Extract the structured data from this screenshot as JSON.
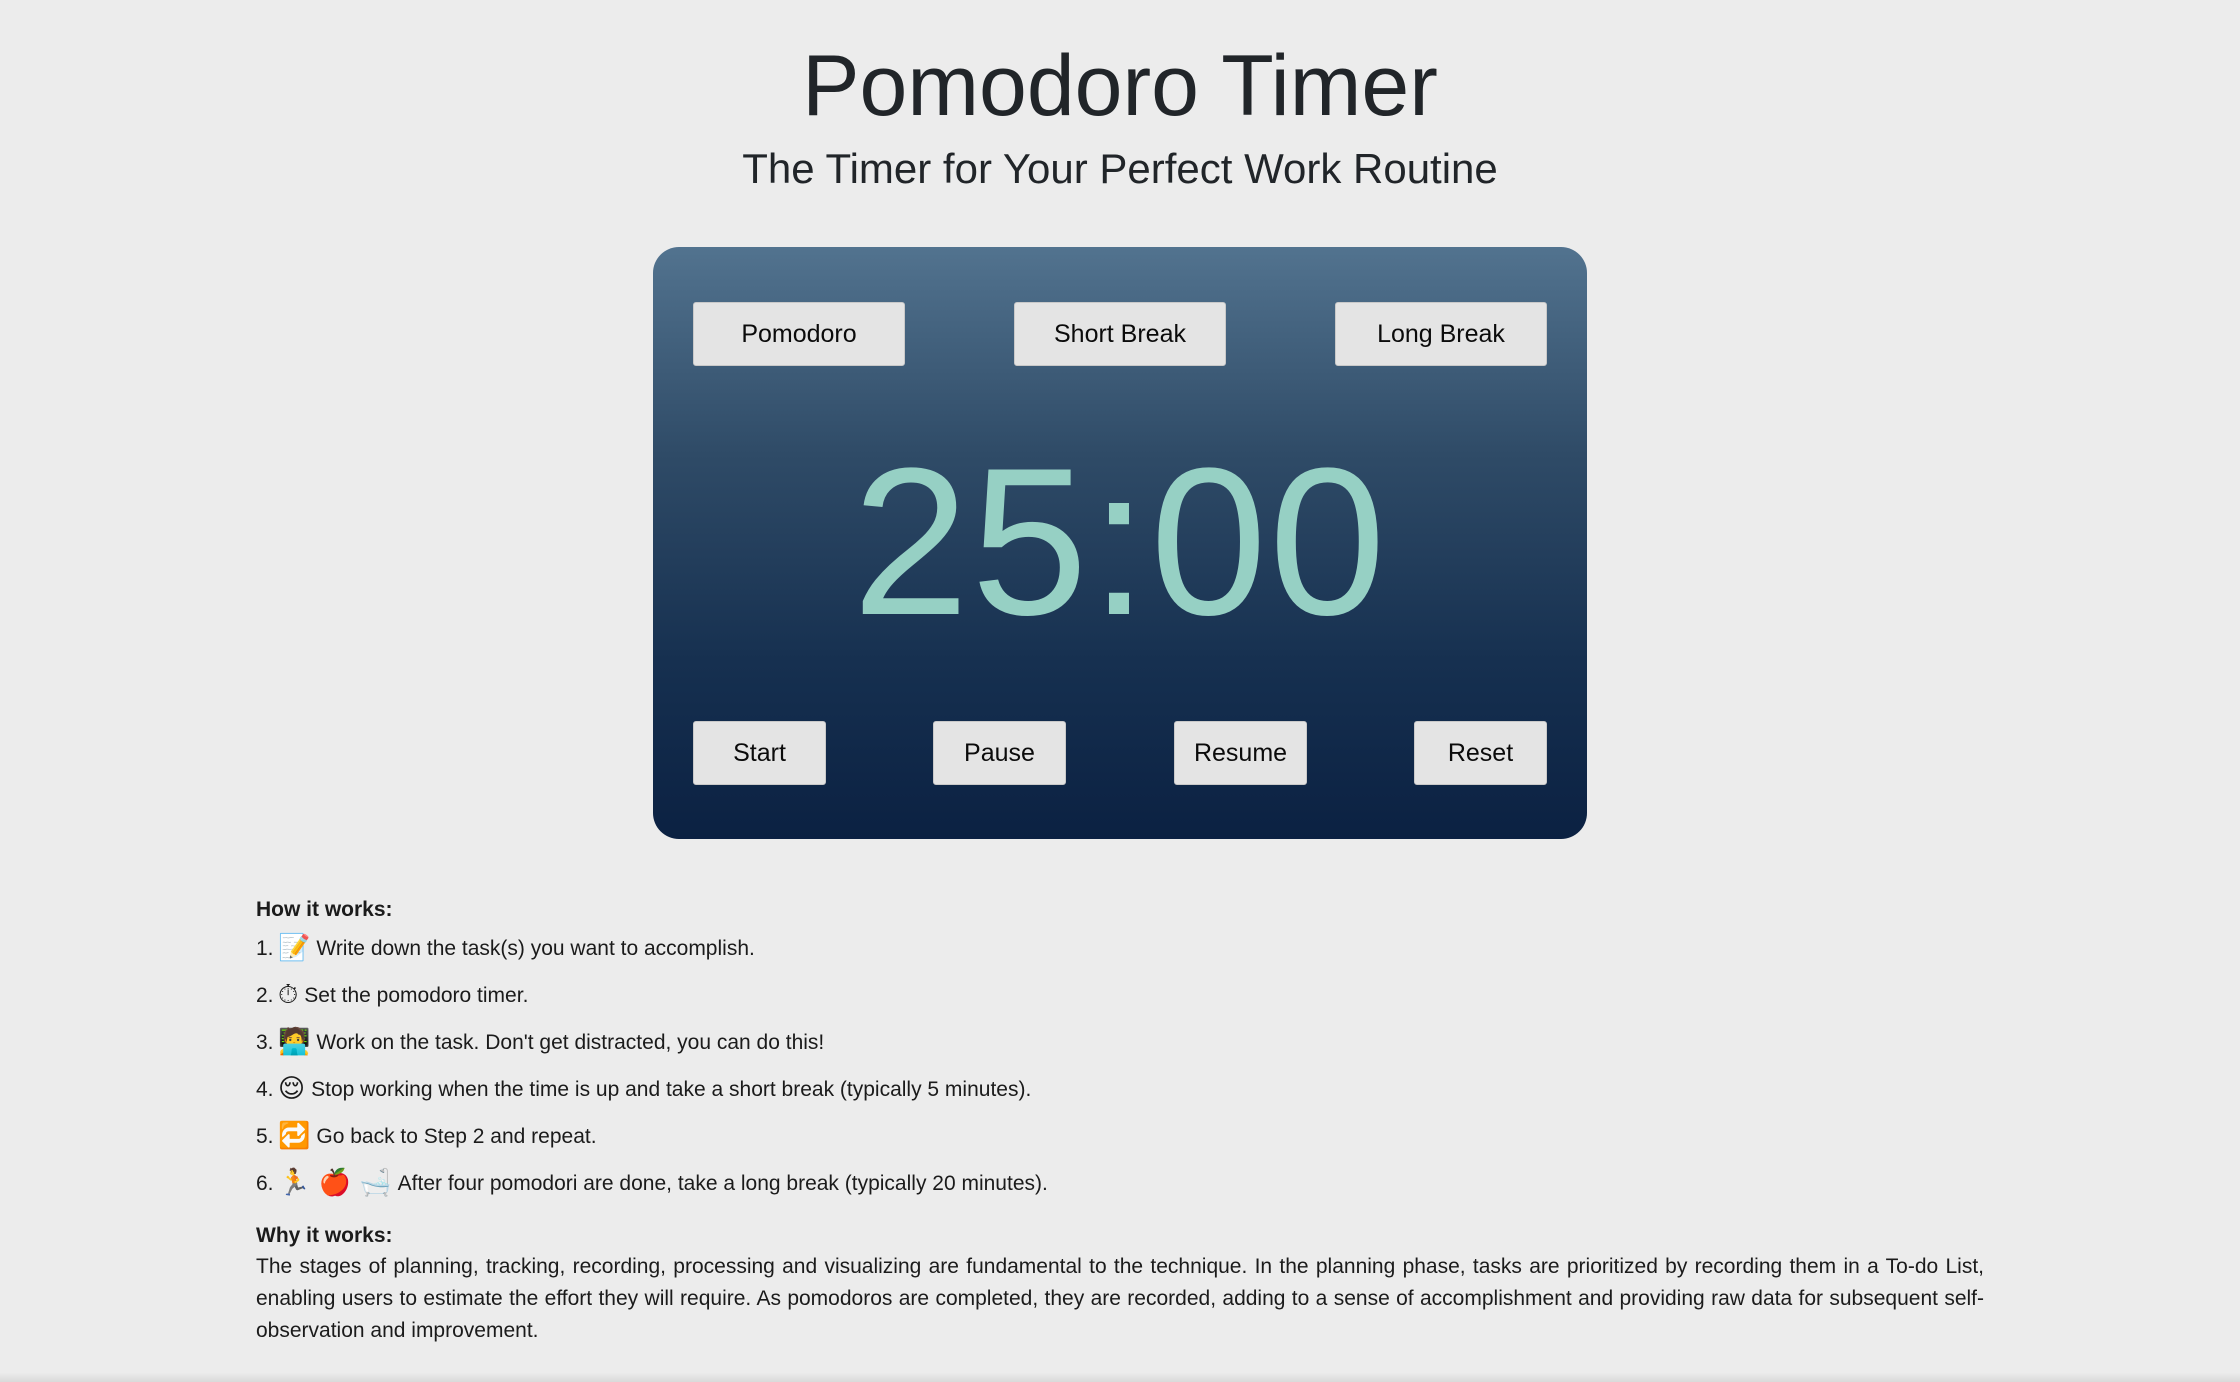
{
  "header": {
    "title": "Pomodoro Timer",
    "subtitle": "The Timer for Your Perfect Work Routine"
  },
  "timer": {
    "modes": [
      {
        "label": "Pomodoro"
      },
      {
        "label": "Short Break"
      },
      {
        "label": "Long Break"
      }
    ],
    "time": "25:00",
    "controls": [
      {
        "label": "Start"
      },
      {
        "label": "Pause"
      },
      {
        "label": "Resume"
      },
      {
        "label": "Reset"
      }
    ],
    "colors": {
      "card_top": "#52738f",
      "card_bottom": "#0b2142",
      "time_text": "#96d0c4",
      "button_bg": "#e4e4e4"
    }
  },
  "how": {
    "heading": "How it works:",
    "steps": [
      {
        "num": "1.",
        "emoji": "📝",
        "icon": "memo-icon",
        "text": "Write down the task(s) you want to accomplish."
      },
      {
        "num": "2.",
        "emoji": "⏱",
        "icon": "stopwatch-icon",
        "text": "Set the pomodoro timer."
      },
      {
        "num": "3.",
        "emoji": "🧑‍💻",
        "icon": "technologist-icon",
        "text": "Work on the task. Don't get distracted, you can do this!"
      },
      {
        "num": "4.",
        "emoji": "😌",
        "icon": "relieved-face-icon",
        "text": "Stop working when the time is up and take a short break (typically 5 minutes)."
      },
      {
        "num": "5.",
        "emoji": "🔁",
        "icon": "repeat-icon",
        "text": "Go back to Step 2 and repeat."
      },
      {
        "num": "6.",
        "emoji": "🏃 🍎 🛁",
        "icon": "runner-apple-bathtub-icons",
        "text": "After four pomodori are done, take a long break (typically 20 minutes)."
      }
    ]
  },
  "why": {
    "heading": "Why it works:",
    "text": "The stages of planning, tracking, recording, processing and visualizing are fundamental to the technique. In the planning phase, tasks are prioritized by recording them in a To-do List, enabling users to estimate the effort they will require. As pomodoros are completed, they are recorded, adding to a sense of accomplishment and providing raw data for subsequent self-observation and improvement."
  }
}
